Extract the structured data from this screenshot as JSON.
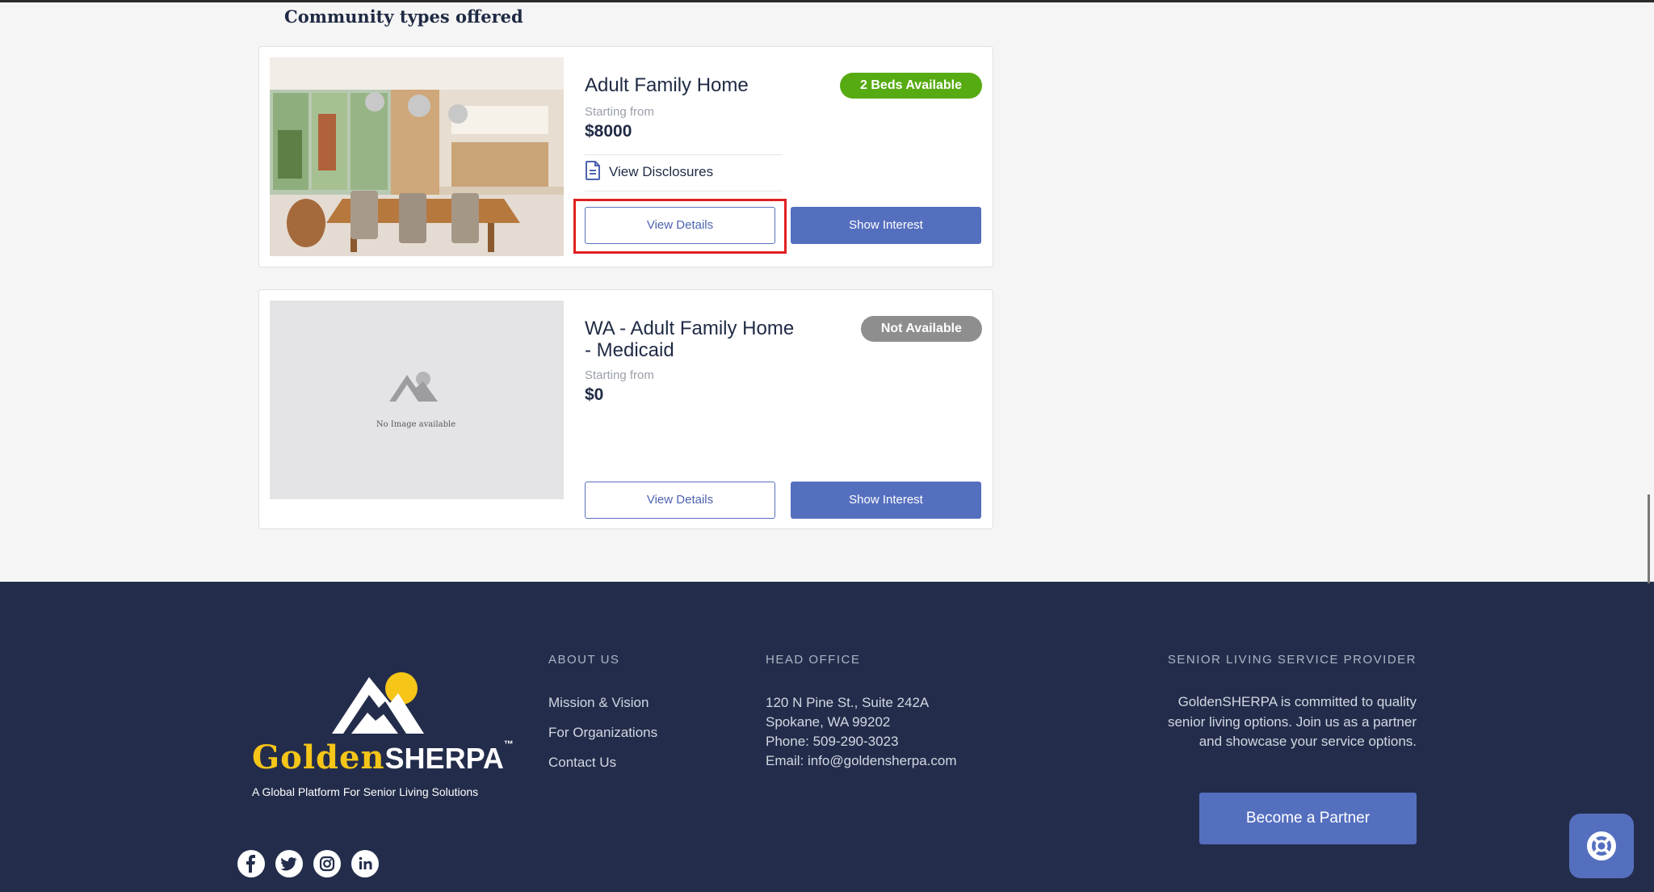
{
  "section": {
    "title": "Community types offered"
  },
  "cards": [
    {
      "title": "Adult Family Home",
      "starting_label": "Starting from",
      "price": "$8000",
      "badge": "2 Beds Available",
      "disclosures_label": "View Disclosures",
      "view_details": "View Details",
      "show_interest": "Show Interest"
    },
    {
      "title": "WA - Adult Family Home - Medicaid",
      "starting_label": "Starting from",
      "price": "$0",
      "badge": "Not Available",
      "no_image_label": "No Image available",
      "view_details": "View Details",
      "show_interest": "Show Interest"
    }
  ],
  "footer": {
    "logo": {
      "golden": "Golden",
      "sherpa": "SHERPA",
      "tm": "™",
      "tagline": "A Global Platform For Senior Living Solutions"
    },
    "about": {
      "heading": "ABOUT US",
      "links": [
        "Mission & Vision",
        "For Organizations",
        "Contact Us"
      ]
    },
    "office": {
      "heading": "HEAD OFFICE",
      "lines": [
        "120 N Pine St., Suite 242A",
        "Spokane, WA 99202",
        "Phone: 509-290-3023",
        "Email: info@goldensherpa.com"
      ]
    },
    "provider": {
      "heading": "SENIOR LIVING SERVICE PROVIDER",
      "text": "GoldenSHERPA is committed to quality senior living options. Join us as a partner and showcase your service options.",
      "button": "Become a Partner"
    },
    "social_icons": [
      "facebook-icon",
      "twitter-icon",
      "instagram-icon",
      "linkedin-icon"
    ]
  },
  "colors": {
    "accent": "#556fbf",
    "available": "#57ab12",
    "unavailable": "#8e8e8e",
    "footer_bg": "#232d4b",
    "logo_gold": "#f5c518",
    "highlight": "#e02020"
  }
}
